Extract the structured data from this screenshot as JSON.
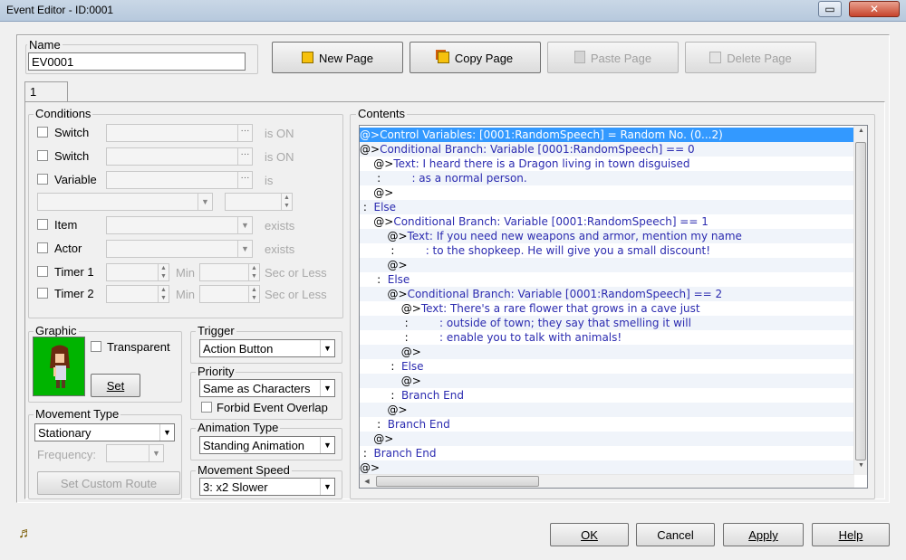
{
  "window": {
    "title": "Event Editor - ID:0001",
    "restore_glyph": "▭",
    "close_glyph": "✕"
  },
  "name": {
    "label": "Name",
    "value": "EV0001"
  },
  "page_buttons": {
    "new": "New Page",
    "copy": "Copy Page",
    "paste": "Paste Page",
    "delete": "Delete Page"
  },
  "tabs": [
    {
      "label": "1"
    }
  ],
  "conditions": {
    "title": "Conditions",
    "switch1": {
      "label": "Switch",
      "suffix": "is ON"
    },
    "switch2": {
      "label": "Switch",
      "suffix": "is ON"
    },
    "variable": {
      "label": "Variable",
      "suffix": "is"
    },
    "item": {
      "label": "Item",
      "suffix": "exists"
    },
    "actor": {
      "label": "Actor",
      "suffix": "exists"
    },
    "timer1": {
      "label": "Timer 1",
      "min": "Min",
      "sec": "Sec or Less"
    },
    "timer2": {
      "label": "Timer 2",
      "min": "Min",
      "sec": "Sec or Less"
    }
  },
  "graphic": {
    "title": "Graphic",
    "transparent": "Transparent",
    "set_label": "Set"
  },
  "movement": {
    "title": "Movement Type",
    "value": "Stationary",
    "frequency_label": "Frequency:",
    "custom_route": "Set Custom Route"
  },
  "trigger": {
    "title": "Trigger",
    "value": "Action Button"
  },
  "priority": {
    "title": "Priority",
    "value": "Same as Characters",
    "forbid": "Forbid Event Overlap"
  },
  "animation": {
    "title": "Animation Type",
    "value": "Standing Animation"
  },
  "speed": {
    "title": "Movement Speed",
    "value": "3: x2 Slower"
  },
  "contents": {
    "title": "Contents",
    "selected_index": 0,
    "lines": [
      {
        "prefix": "@>",
        "text": "Control Variables: [0001:RandomSpeech] = Random No. (0...2)"
      },
      {
        "prefix": "@>",
        "text": "Conditional Branch: Variable [0001:RandomSpeech] == 0"
      },
      {
        "prefix": "    @>",
        "text": "Text: I heard there is a Dragon living in town disguised"
      },
      {
        "prefix": "     :         ",
        "text": ": as a normal person."
      },
      {
        "prefix": "    @>",
        "text": ""
      },
      {
        "prefix": " :  ",
        "text": "Else"
      },
      {
        "prefix": "    @>",
        "text": "Conditional Branch: Variable [0001:RandomSpeech] == 1"
      },
      {
        "prefix": "        @>",
        "text": "Text: If you need new weapons and armor, mention my name"
      },
      {
        "prefix": "         :         ",
        "text": ": to the shopkeep. He will give you a small discount!"
      },
      {
        "prefix": "        @>",
        "text": ""
      },
      {
        "prefix": "     :  ",
        "text": "Else"
      },
      {
        "prefix": "        @>",
        "text": "Conditional Branch: Variable [0001:RandomSpeech] == 2"
      },
      {
        "prefix": "            @>",
        "text": "Text: There's a rare flower that grows in a cave just"
      },
      {
        "prefix": "             :         ",
        "text": ": outside of town; they say that smelling it will"
      },
      {
        "prefix": "             :         ",
        "text": ": enable you to talk with animals!"
      },
      {
        "prefix": "            @>",
        "text": ""
      },
      {
        "prefix": "         :  ",
        "text": "Else"
      },
      {
        "prefix": "            @>",
        "text": ""
      },
      {
        "prefix": "         :  ",
        "text": "Branch End"
      },
      {
        "prefix": "        @>",
        "text": ""
      },
      {
        "prefix": "     :  ",
        "text": "Branch End"
      },
      {
        "prefix": "    @>",
        "text": ""
      },
      {
        "prefix": " :  ",
        "text": "Branch End"
      },
      {
        "prefix": "@>",
        "text": ""
      }
    ]
  },
  "footer": {
    "ok": "OK",
    "cancel": "Cancel",
    "apply": "Apply",
    "help": "Help",
    "music_icon": "♬"
  },
  "colors": {
    "selection": "#3399ff",
    "command_text": "#2b2bb0",
    "graphic_bg": "#00b400"
  }
}
